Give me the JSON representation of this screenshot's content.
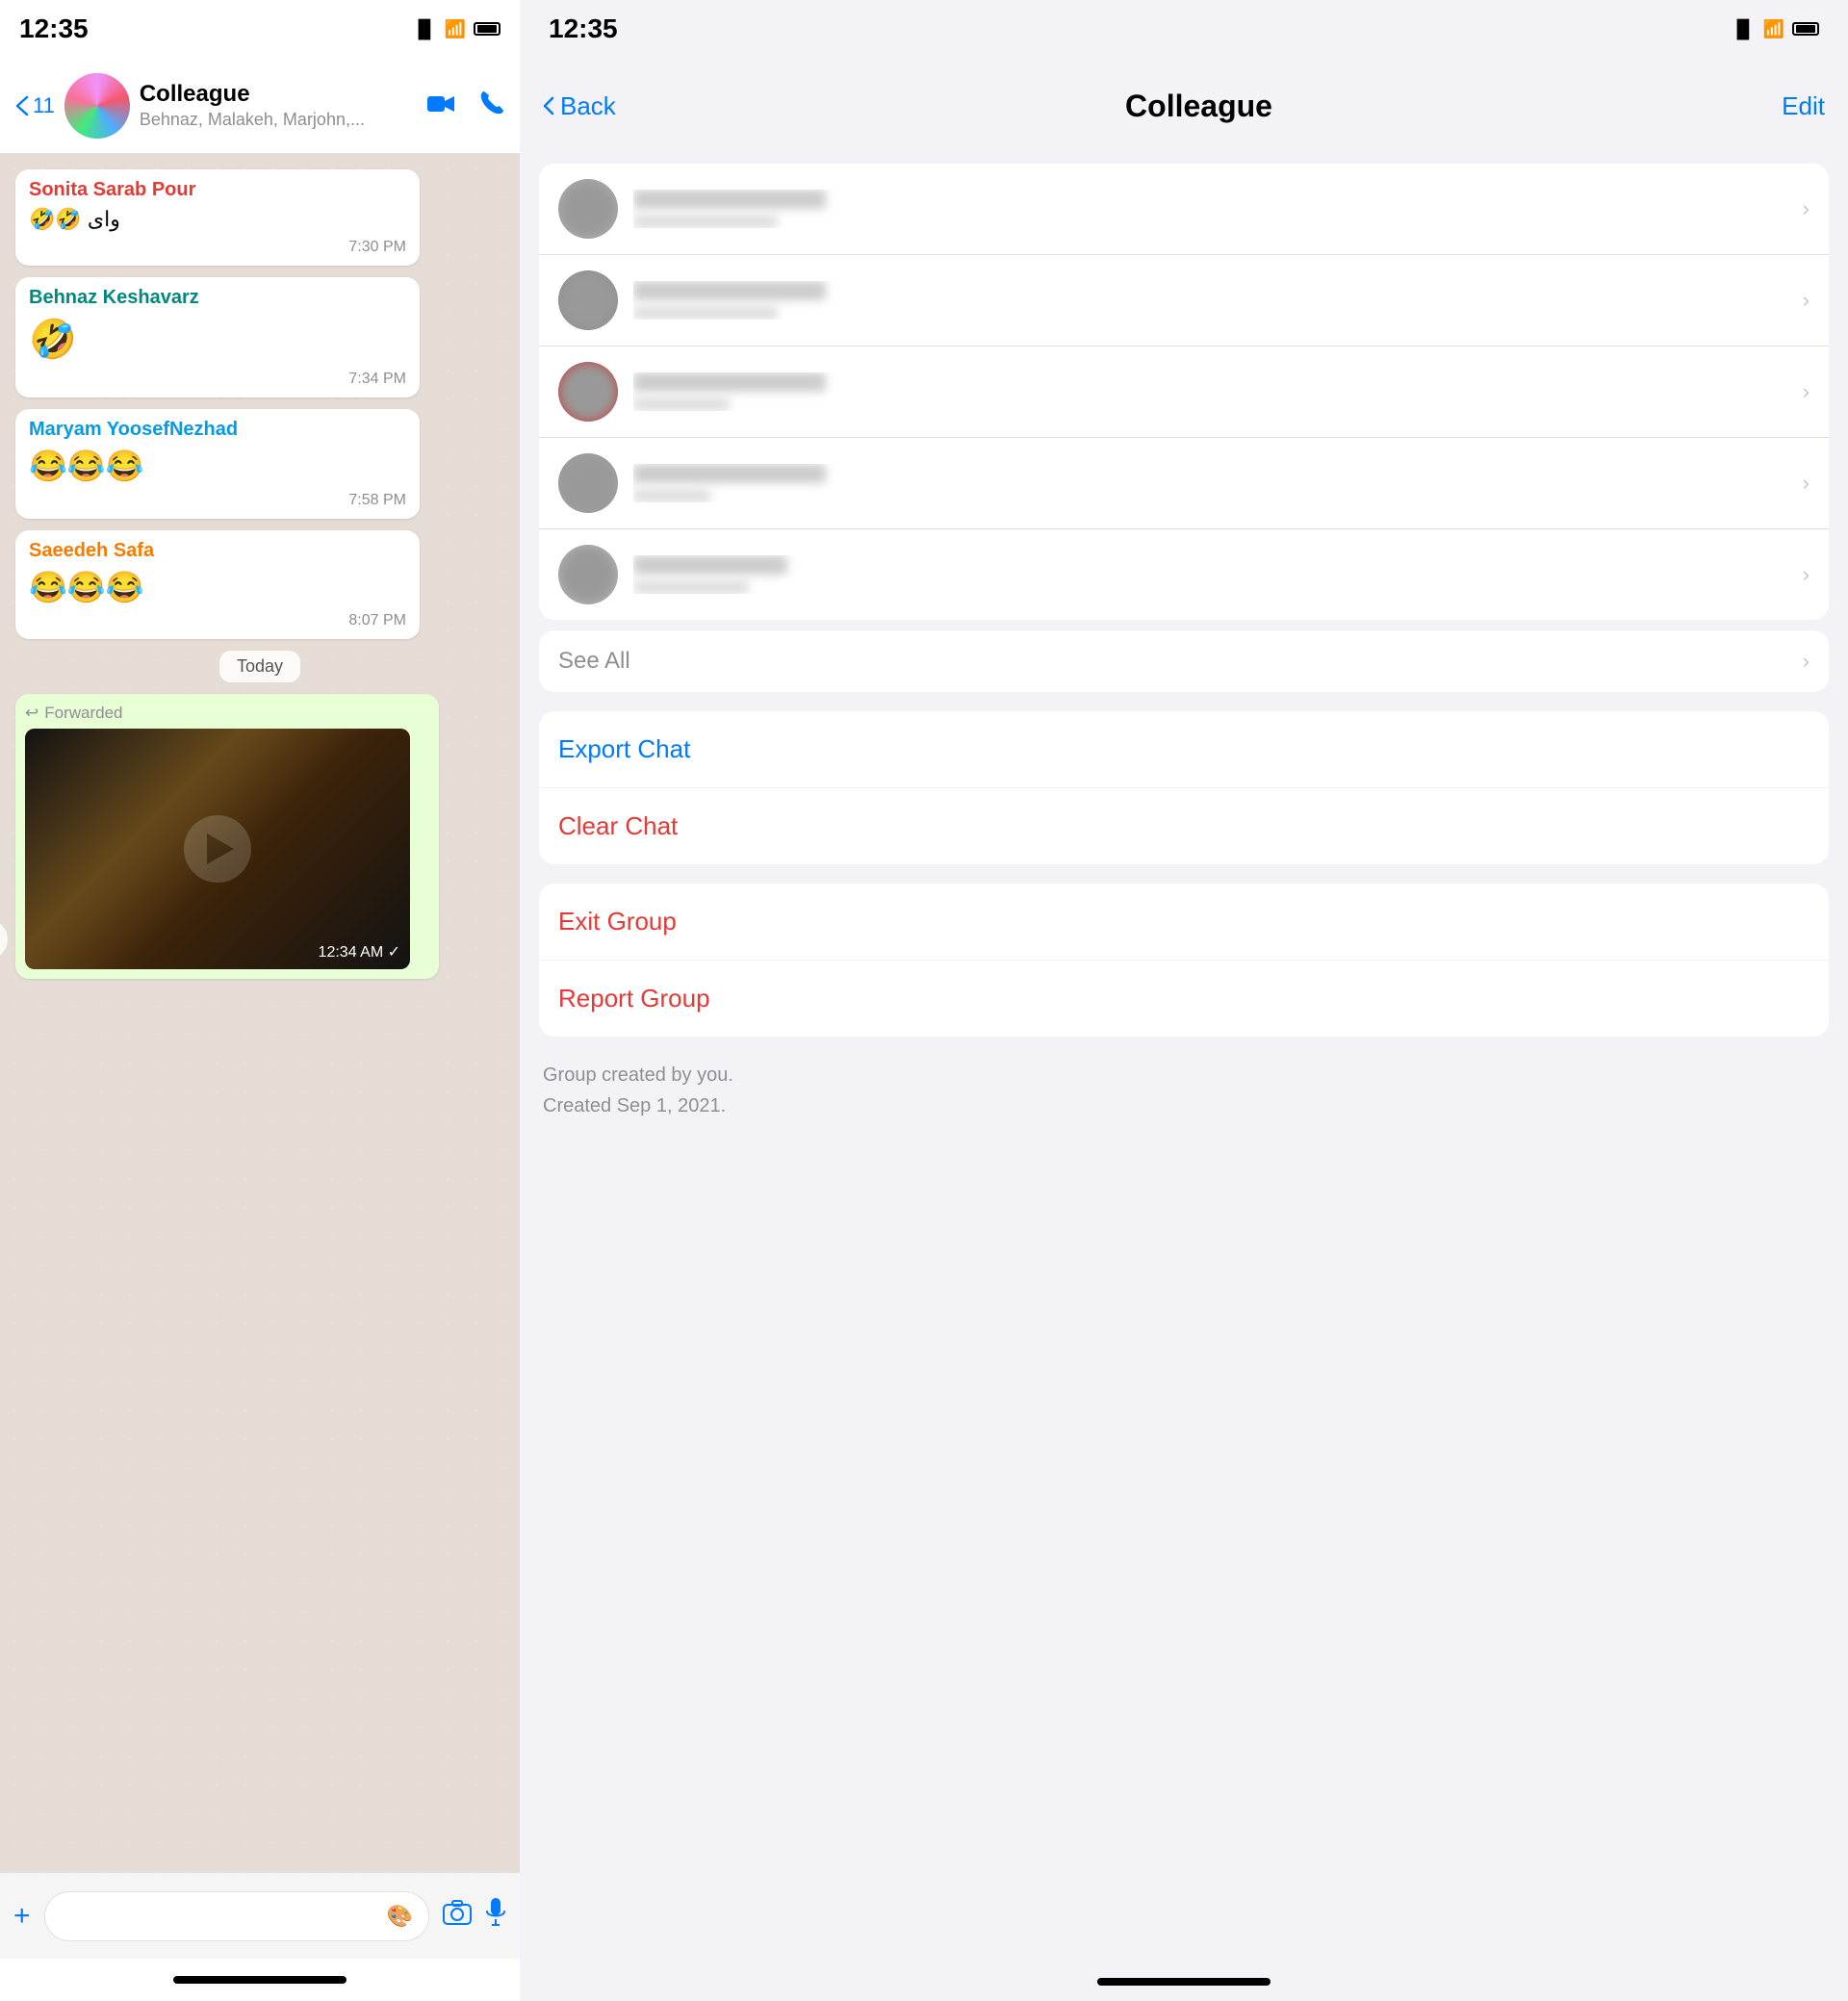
{
  "left": {
    "statusBar": {
      "time": "12:35",
      "signalIcon": "signal",
      "wifiIcon": "wifi",
      "batteryIcon": "battery"
    },
    "header": {
      "backCount": "11",
      "groupName": "Colleague",
      "members": "Behnaz, Malakeh, Marjohn,...",
      "videoIcon": "video-camera",
      "phoneIcon": "phone"
    },
    "messages": [
      {
        "sender": "Sonita Sarab Pour",
        "senderClass": "sender-red",
        "text": "🤣🤣 وای",
        "time": "7:30 PM"
      },
      {
        "sender": "Behnaz Keshavarz",
        "senderClass": "sender-green",
        "text": "🤣",
        "time": "7:34 PM"
      },
      {
        "sender": "Maryam YoosefNezhad",
        "senderClass": "sender-blue",
        "text": "😂😂😂",
        "time": "7:58 PM"
      },
      {
        "sender": "Saeedeh Safa",
        "senderClass": "sender-orange",
        "text": "😂😂😂",
        "time": "8:07 PM"
      }
    ],
    "dateDivider": "Today",
    "forwardedLabel": "Forwarded",
    "videoTimeOverlay": "12:34 AM ✓",
    "inputBar": {
      "addIcon": "+",
      "placeholder": "",
      "stickerIcon": "🎨",
      "cameraIcon": "📷",
      "micIcon": "🎤"
    }
  },
  "right": {
    "statusBar": {
      "time": "12:35",
      "signalIcon": "signal",
      "wifiIcon": "wifi",
      "batteryIcon": "battery"
    },
    "header": {
      "backLabel": "Back",
      "title": "Colleague",
      "editLabel": "Edit"
    },
    "members": [
      {
        "avatarColor": "#b0b0b0"
      },
      {
        "avatarColor": "#909090"
      },
      {
        "avatarColor": "#c04040"
      },
      {
        "avatarColor": "#a0a0a0"
      },
      {
        "avatarColor": "#b0b0b0"
      }
    ],
    "seeAll": "See All",
    "actions": {
      "exportChat": "Export Chat",
      "clearChat": "Clear Chat"
    },
    "dangerActions": {
      "exitGroup": "Exit Group",
      "reportGroup": "Report Group"
    },
    "footer": {
      "line1": "Group created by you.",
      "line2": "Created Sep 1, 2021."
    }
  }
}
